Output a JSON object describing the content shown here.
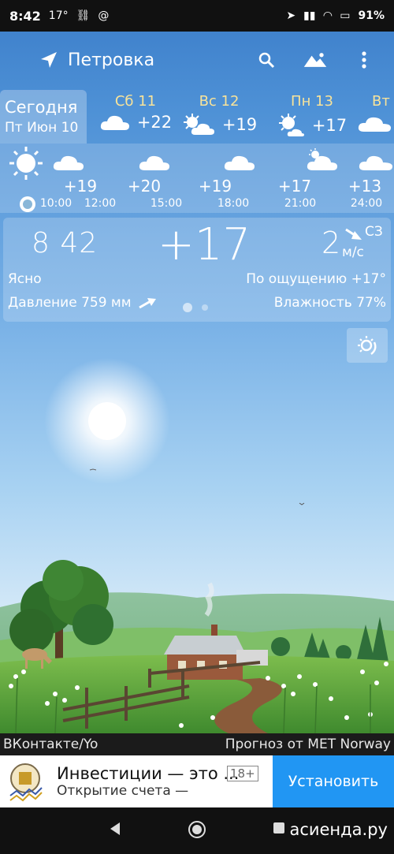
{
  "status_bar": {
    "time": "8:42",
    "notif": "17°",
    "battery": "91%"
  },
  "app_bar": {
    "city": "Петровка"
  },
  "today": {
    "label": "Сегодня",
    "date": "Пт Июн 10"
  },
  "days": [
    {
      "name": "Сб 11",
      "temp": "+22",
      "icon": "cloud-icon"
    },
    {
      "name": "Вс 12",
      "temp": "+19",
      "icon": "partly-cloudy-icon"
    },
    {
      "name": "Пн 13",
      "temp": "+17",
      "icon": "partly-cloudy-icon"
    },
    {
      "name": "Вт",
      "temp": "",
      "icon": "cloud-icon"
    }
  ],
  "hourly": [
    {
      "time": "10:00",
      "temp": "",
      "icon": "sun-icon"
    },
    {
      "time": "12:00",
      "temp": "+19",
      "icon": "cloud-icon"
    },
    {
      "time": "15:00",
      "temp": "+20",
      "icon": "cloud-icon"
    },
    {
      "time": "18:00",
      "temp": "+19",
      "icon": "cloud-icon"
    },
    {
      "time": "21:00",
      "temp": "+17",
      "icon": "partly-cloudy-icon"
    },
    {
      "time": "24:00",
      "temp": "+13",
      "icon": "cloud-icon"
    }
  ],
  "current": {
    "clock": "8 42",
    "temp": "+17",
    "wind_speed": "2",
    "wind_dir": "СЗ",
    "wind_unit": "м/с",
    "condition": "Ясно",
    "feels_like": "По ощущению +17°",
    "pressure": "Давление 759 мм",
    "humidity": "Влажность 77%"
  },
  "credits": {
    "left": "ВКонтакте/Yo",
    "right": "Прогноз от MET Norway"
  },
  "ad": {
    "title": "Инвестиции — это ...",
    "subtitle": "Открытие счета —",
    "age": "18+",
    "button": "Установить"
  },
  "watermark": "асиенда.ру"
}
